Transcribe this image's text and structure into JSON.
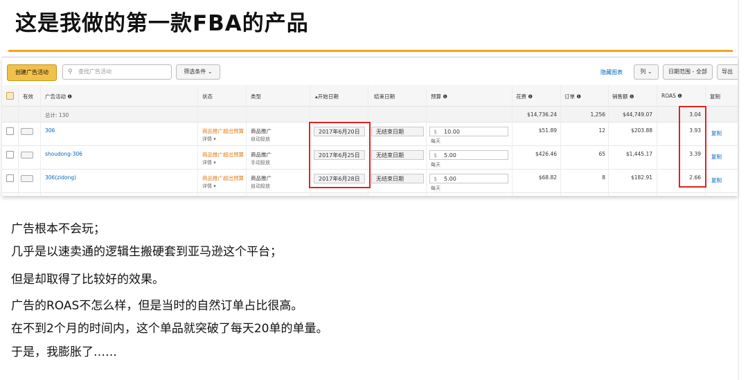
{
  "title": "这是我做的第一款FBA的产品",
  "toolbar": {
    "create_label": "创建广告活动",
    "search_placeholder": "查找广告活动",
    "filter_label": "筛选条件 ⌄",
    "hide_chart_label": "隐藏图表",
    "columns_label": "列 ⌄",
    "date_range_label": "日期范围 - 全部",
    "export_label": "导出"
  },
  "table": {
    "headers": {
      "active": "有效",
      "campaign": "广告活动 ❶",
      "status": "状态",
      "type": "类型",
      "start_date": "▴开始日期",
      "end_date": "结束日期",
      "budget": "预算 ❶",
      "spend": "花费 ❶",
      "orders": "订单 ❶",
      "sales": "销售额 ❶",
      "roas": "ROAS ❶",
      "copy": "复制"
    },
    "total": {
      "label": "总计: 130",
      "spend": "$14,736.24",
      "orders": "1,256",
      "sales": "$44,749.07",
      "roas": "3.04"
    },
    "rows": [
      {
        "name": "306",
        "status": "商品推广超出预算",
        "status_detail": "详情 ▾",
        "type": "商品推广",
        "type_detail": "自动投放",
        "start_date": "2017年6月20日",
        "end_date": "无结束日期",
        "currency": "$",
        "budget": "10.00",
        "budget_period": "每天",
        "spend": "$51.89",
        "orders": "12",
        "sales": "$203.88",
        "roas": "3.93",
        "copy": "复制"
      },
      {
        "name": "shoudong-306",
        "status": "商品推广超出预算",
        "status_detail": "详情 ▾",
        "type": "商品推广",
        "type_detail": "手动投放",
        "start_date": "2017年6月25日",
        "end_date": "无结束日期",
        "currency": "$",
        "budget": "5.00",
        "budget_period": "每天",
        "spend": "$426.46",
        "orders": "65",
        "sales": "$1,445.17",
        "roas": "3.39",
        "copy": "复制"
      },
      {
        "name": "306(zidong)",
        "status": "商品推广超出预算",
        "status_detail": "详情 ▾",
        "type": "商品推广",
        "type_detail": "自动投放",
        "start_date": "2017年6月28日",
        "end_date": "无结束日期",
        "currency": "$",
        "budget": "5.00",
        "budget_period": "每天",
        "spend": "$68.82",
        "orders": "8",
        "sales": "$182.91",
        "roas": "2.66",
        "copy": "复制"
      }
    ]
  },
  "body_lines": [
    "广告根本不会玩；",
    "几乎是以速卖通的逻辑生搬硬套到亚马逊这个平台；",
    "但是却取得了比较好的效果。",
    "广告的ROAS不怎么样，但是当时的自然订单占比很高。",
    "在不到2个月的时间内，这个单品就突破了每天20单的单量。",
    "于是，我膨胀了……"
  ],
  "colors": {
    "accent_line": "#f3a51a",
    "button_yellow": "#f0c14b",
    "link": "#0066c0",
    "status_orange": "#e47911",
    "highlight_red": "#e02020"
  }
}
